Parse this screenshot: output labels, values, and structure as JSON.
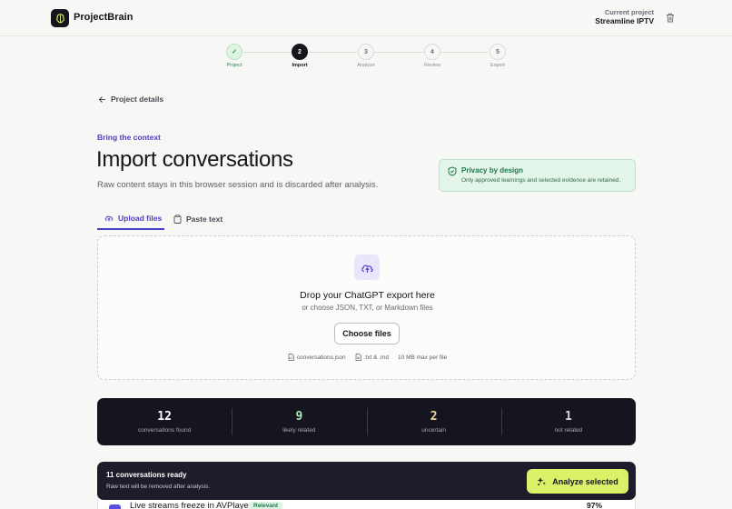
{
  "app": {
    "name": "ProjectBrain"
  },
  "project": {
    "label": "Current project",
    "name": "Streamline IPTV"
  },
  "stepper": {
    "steps": [
      {
        "number": "✓",
        "label": "Project",
        "state": "done"
      },
      {
        "number": "2",
        "label": "Import",
        "state": "active"
      },
      {
        "number": "3",
        "label": "Analyze",
        "state": "upcoming"
      },
      {
        "number": "4",
        "label": "Review",
        "state": "upcoming"
      },
      {
        "number": "5",
        "label": "Export",
        "state": "upcoming"
      }
    ]
  },
  "nav": {
    "back_label": "Project details"
  },
  "header": {
    "eyebrow": "Bring the context",
    "title": "Import conversations",
    "subtitle": "Raw content stays in this browser session and is discarded after analysis."
  },
  "privacy": {
    "title": "Privacy by design",
    "text": "Only approved learnings and selected evidence are retained."
  },
  "tabs": [
    {
      "label": "Upload files",
      "active": true
    },
    {
      "label": "Paste text",
      "active": false
    }
  ],
  "dropzone": {
    "title": "Drop your ChatGPT export here",
    "subtitle": "or choose JSON, TXT, or Markdown files",
    "button": "Choose files",
    "hints": [
      "conversations.json",
      ".txt & .md",
      "10 MB max per file"
    ]
  },
  "stats": [
    {
      "value": "12",
      "label": "conversations found",
      "color": "#ffffff"
    },
    {
      "value": "9",
      "label": "likely related",
      "color": "#a9e7b3"
    },
    {
      "value": "2",
      "label": "uncertain",
      "color": "#f2d59a"
    },
    {
      "value": "1",
      "label": "not related",
      "color": "#d7d7de"
    }
  ],
  "conversation_row": {
    "title": "Live streams freeze in AVPlayer",
    "badge": "Relevant",
    "score": "97%"
  },
  "ready_bar": {
    "title": "11 conversations ready",
    "subtitle": "Raw text will be removed after analysis.",
    "button": "Analyze selected"
  },
  "colors": {
    "accent": "#4b3fc4",
    "cta": "#d9f26a",
    "dark": "#15151f",
    "success": "#21764a"
  }
}
